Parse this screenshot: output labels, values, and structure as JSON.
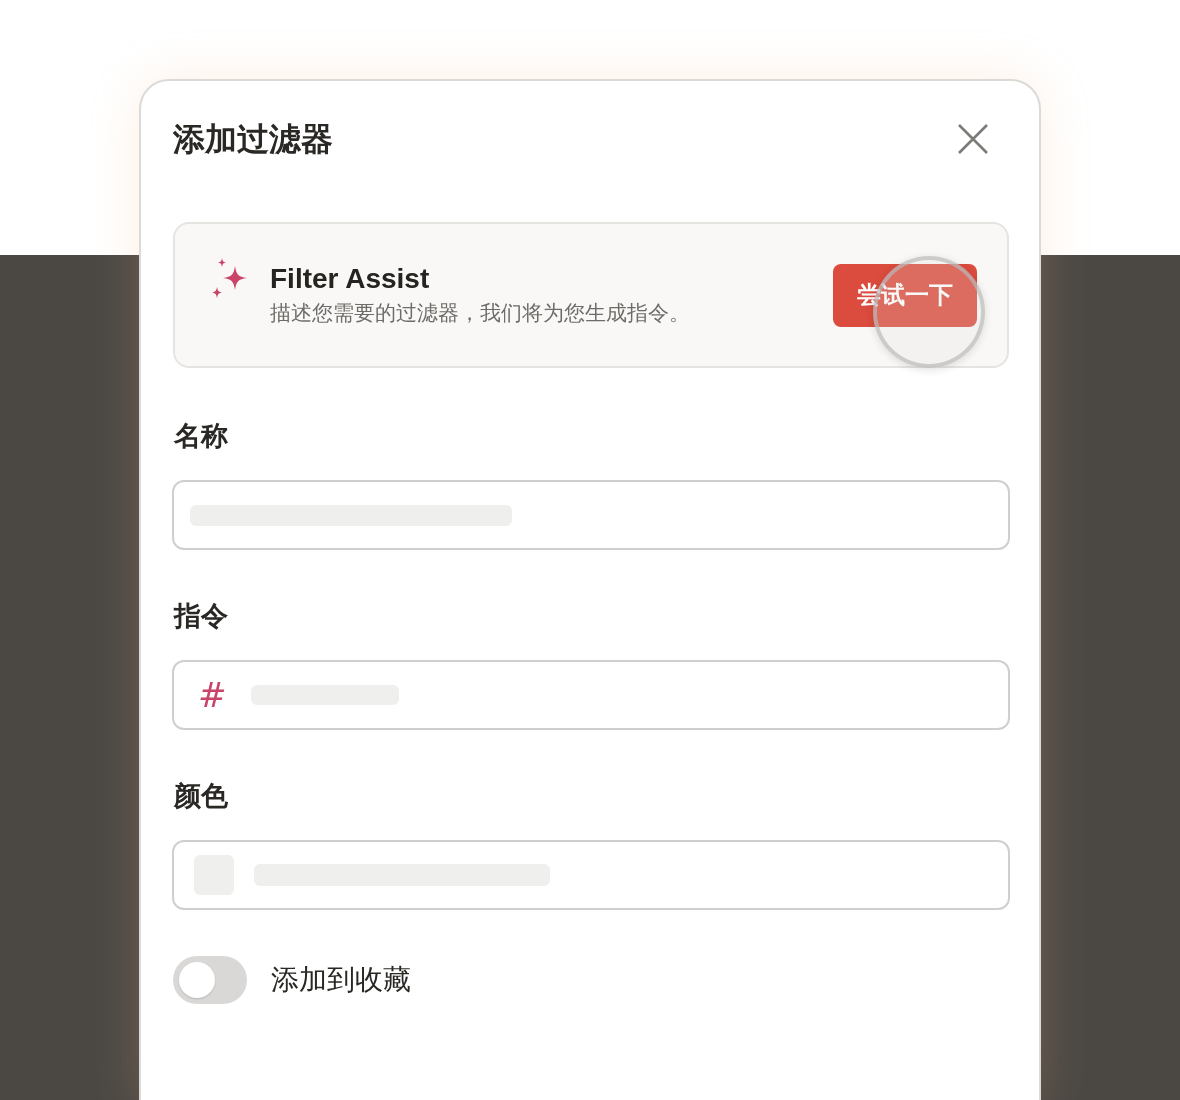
{
  "dialog": {
    "title": "添加过滤器"
  },
  "assist": {
    "title": "Filter Assist",
    "description": "描述您需要的过滤器，我们将为您生成指令。",
    "button": "尝试一下"
  },
  "fields": [
    {
      "kind": "text",
      "label": "名称"
    },
    {
      "kind": "command",
      "label": "指令",
      "prefix": "#"
    },
    {
      "kind": "color",
      "label": "颜色"
    }
  ],
  "favorite": {
    "label": "添加到收藏",
    "on": false
  }
}
